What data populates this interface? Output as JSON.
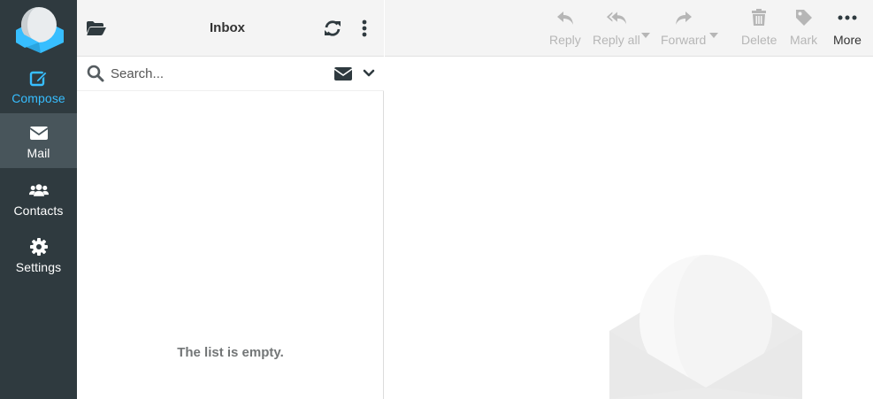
{
  "nav": {
    "items": [
      {
        "id": "compose",
        "label": "Compose",
        "icon": "compose-icon"
      },
      {
        "id": "mail",
        "label": "Mail",
        "icon": "envelope-icon",
        "selected": true
      },
      {
        "id": "contacts",
        "label": "Contacts",
        "icon": "users-icon"
      },
      {
        "id": "settings",
        "label": "Settings",
        "icon": "gear-icon"
      }
    ]
  },
  "list": {
    "title": "Inbox",
    "search_placeholder": "Search...",
    "empty_message": "The list is empty."
  },
  "toolbar": {
    "buttons": [
      {
        "id": "reply",
        "label": "Reply",
        "icon": "reply-icon",
        "enabled": false
      },
      {
        "id": "reply-all",
        "label": "Reply all",
        "icon": "reply-all-icon",
        "enabled": false
      },
      {
        "id": "forward",
        "label": "Forward",
        "icon": "forward-icon",
        "enabled": false
      },
      {
        "id": "delete",
        "label": "Delete",
        "icon": "trash-icon",
        "enabled": false
      },
      {
        "id": "mark",
        "label": "Mark",
        "icon": "tag-icon",
        "enabled": false
      },
      {
        "id": "more",
        "label": "More",
        "icon": "ellipsis-icon",
        "enabled": true
      }
    ]
  },
  "colors": {
    "nav_bg": "#2f3a3f",
    "nav_selected_bg": "#48555b",
    "accent": "#37beff",
    "disabled_text": "#b6b6b6",
    "toolbar_bg": "#f4f4f4"
  }
}
